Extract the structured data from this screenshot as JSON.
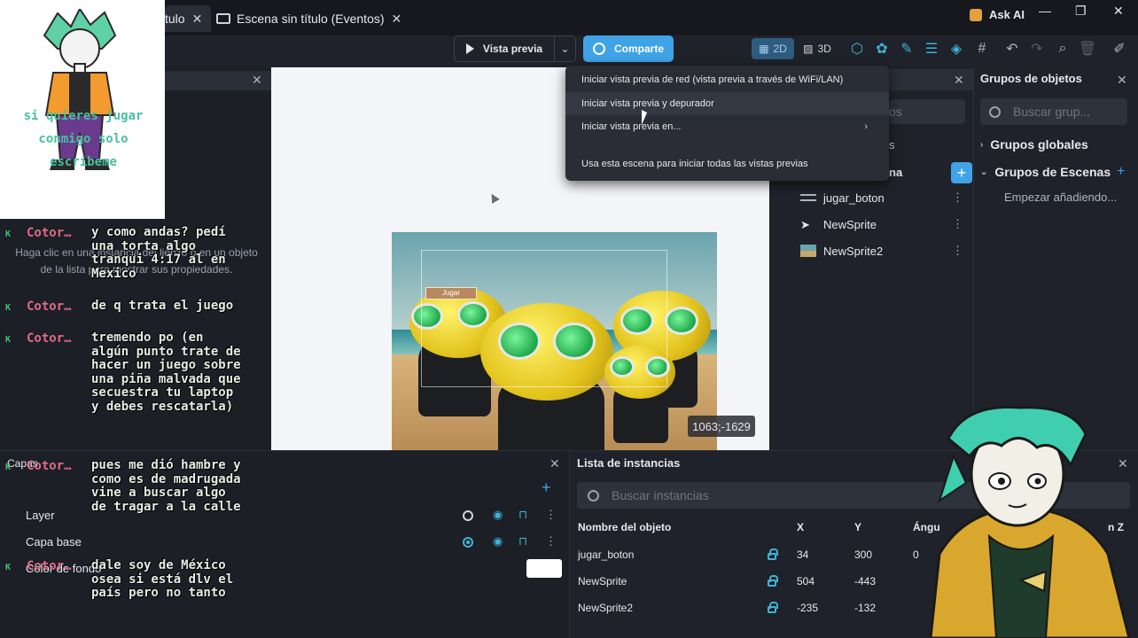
{
  "tabs": {
    "active_tail": "tulo",
    "second": "Escena sin título (Eventos)",
    "close": "✕"
  },
  "window": {
    "ask_ai": "Ask AI",
    "minimize": "—",
    "maximize": "❐",
    "close": "✕"
  },
  "toolbar": {
    "preview": "Vista previa",
    "share": "Comparte",
    "mode_2d": "2D",
    "mode_3d": "3D",
    "icons": [
      "cube-icon",
      "objects-icon",
      "edit-icon",
      "list-icon",
      "layers-icon",
      "grid-icon",
      "undo-icon",
      "redo-icon",
      "zoom-icon",
      "delete-icon",
      "edit-window-icon"
    ]
  },
  "preview_menu": {
    "items": [
      "Iniciar vista previa de red (vista previa a través de WiFi/LAN)",
      "Iniciar vista previa y depurador",
      "Iniciar vista previa en...",
      "Usa esta escena para iniciar todas las vistas previas"
    ],
    "submenu_arrow": "›"
  },
  "left_panel": {
    "hint": "Haga clic en una instancia del lienzo o en un objeto de la lista para mostrar sus propiedades."
  },
  "sticker": {
    "text": "si quieres jugar conmigo solo escribeme"
  },
  "chat": [
    {
      "user": "Cotor…",
      "text": "y como andas? pedí una torta algo tranqui 4:17 al en Mexico"
    },
    {
      "user": "Cotor…",
      "text": "de q trata el juego"
    },
    {
      "user": "Cotor…",
      "text": "tremendo po (en algún punto trate de hacer un juego sobre una piña malvada que secuestra tu laptop y debes rescatarla)"
    },
    {
      "user": "Cotor…",
      "text": "pues me dió hambre y como es de madrugada vine a buscar algo de tragar a la calle"
    },
    {
      "user": "Cotor…",
      "text": "dale soy de México osea si está dlv el país pero no tanto"
    }
  ],
  "canvas": {
    "button_label": "Jugar",
    "coordinates": "1063;-1629"
  },
  "objects_panel": {
    "search_tail": "os",
    "s_tail": "s",
    "na_tail": "na",
    "items": [
      {
        "name": "jugar_boton",
        "icon": "text-icon"
      },
      {
        "name": "NewSprite",
        "icon": "cursor-icon"
      },
      {
        "name": "NewSprite2",
        "icon": "image-icon"
      }
    ],
    "dots": "⋮"
  },
  "groups_panel": {
    "title": "Grupos de objetos",
    "search_placeholder": "Buscar grup...",
    "global": "Grupos globales",
    "scene": "Grupos de Escenas",
    "empty": "Empezar añadiendo..."
  },
  "layers_panel": {
    "title": "Capas",
    "layers": [
      "Layer",
      "Capa base"
    ],
    "background": "Color de fondo",
    "add": "+"
  },
  "instances_panel": {
    "title": "Lista de instancias",
    "search_placeholder": "Buscar instancias",
    "columns": [
      "Nombre del objeto",
      "X",
      "Y",
      "Ángu",
      "n Z"
    ],
    "rows": [
      {
        "name": "jugar_boton",
        "x": "34",
        "y": "300",
        "angle": "0"
      },
      {
        "name": "NewSprite",
        "x": "504",
        "y": "-443",
        "angle": ""
      },
      {
        "name": "NewSprite2",
        "x": "-235",
        "y": "-132",
        "angle": ""
      }
    ]
  },
  "colors": {
    "accent": "#3fa3e6",
    "chat_user": "#e06a86",
    "chat_badge": "#3ec36b"
  }
}
